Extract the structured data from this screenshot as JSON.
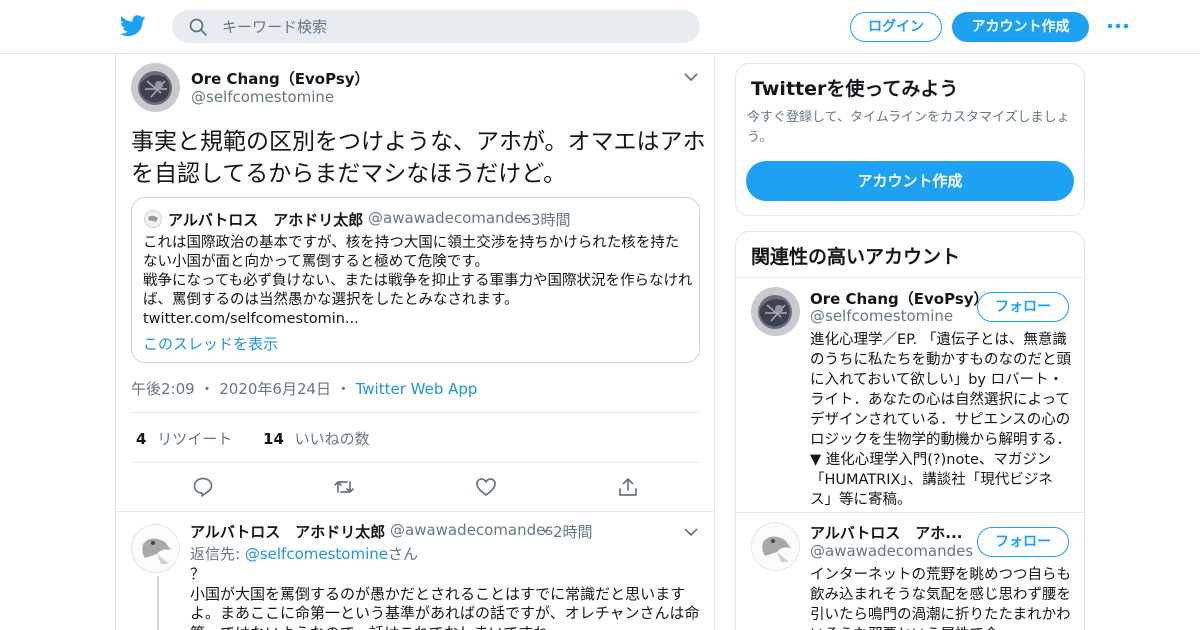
{
  "header": {
    "search_placeholder": "キーワード検索",
    "login_label": "ログイン",
    "signup_label": "アカウント作成",
    "logo_icon": "twitter-bird-icon",
    "brand_color": "#1da1f2"
  },
  "tweet": {
    "author_name": "Ore Chang（EvoPsy）",
    "author_handle": "@selfcomestomine",
    "text": "事実と規範の区別をつけような、アホが。オマエはアホを自認してるからまだマシなほうだけど。",
    "quote": {
      "author_name": "アルバトロス　アホドリ太郎",
      "author_handle": "@awawadecomandes",
      "time": "3時間",
      "body": "これは国際政治の基本ですが、核を持つ大国に領土交渉を持ちかけられた核を持たない小国が面と向かって罵倒すると極めて危険です。\n戦争になっても必ず負けない、または戦争を抑止する軍事力や国際状況を作らなければ、罵倒するのは当然愚かな選択をしたとみなされます。\ntwitter.com/selfcomestomin...",
      "show_thread": "このスレッドを表示"
    },
    "time": "午後2:09",
    "date": "2020年6月24日",
    "source": "Twitter Web App",
    "retweet_count": "4",
    "retweet_label": "リツイート",
    "like_count": "14",
    "like_label": "いいねの数"
  },
  "reply": {
    "author_name": "アルバトロス　アホドリ太郎",
    "author_handle": "@awawadecomandes",
    "time": "2時間",
    "reply_to_prefix": "返信先: ",
    "reply_to_handle": "@selfcomestomine",
    "reply_to_suffix": "さん",
    "body": "？\n小国が大国を罵倒するのが愚かだとされることはすでに常識だと思いますよ。まあここに命第一という基準があればの話ですが、オレチャンさんは命第一ではないようなので、話はこれでおしまいですね。"
  },
  "sidebar": {
    "signup_card": {
      "title": "Twitterを使ってみよう",
      "description": "今すぐ登録して、タイムラインをカスタマイズしましょう。",
      "button": "アカウント作成"
    },
    "related": {
      "title": "関連性の高いアカウント",
      "accounts": [
        {
          "name": "Ore Chang（EvoPsy）",
          "handle": "@selfcomestomine",
          "follow_label": "フォロー",
          "bio": "進化心理学／EP. 「遺伝子とは、無意識のうちに私たちを動かすものなのだと頭に入れておいて欲しい」by ロバート・ライト．あなたの心は自然選択によってデザインされている．サピエンスの心のロジックを生物学的動機から解明する． ▼ 進化心理学入門(?)note、マガジン「HUMATRIX」、講談社「現代ビジネス」等に寄稿。"
        },
        {
          "name": "アルバトロス　アホ...",
          "handle": "@awawadecomandes",
          "follow_label": "フォロー",
          "bio": "インターネットの荒野を眺めつつ自らも飲み込まれそうな気配を感じ思わず腰を引いたら鳴門の渦潮に折りたたまれかわいそうな邪悪という属性で会"
        }
      ]
    }
  }
}
